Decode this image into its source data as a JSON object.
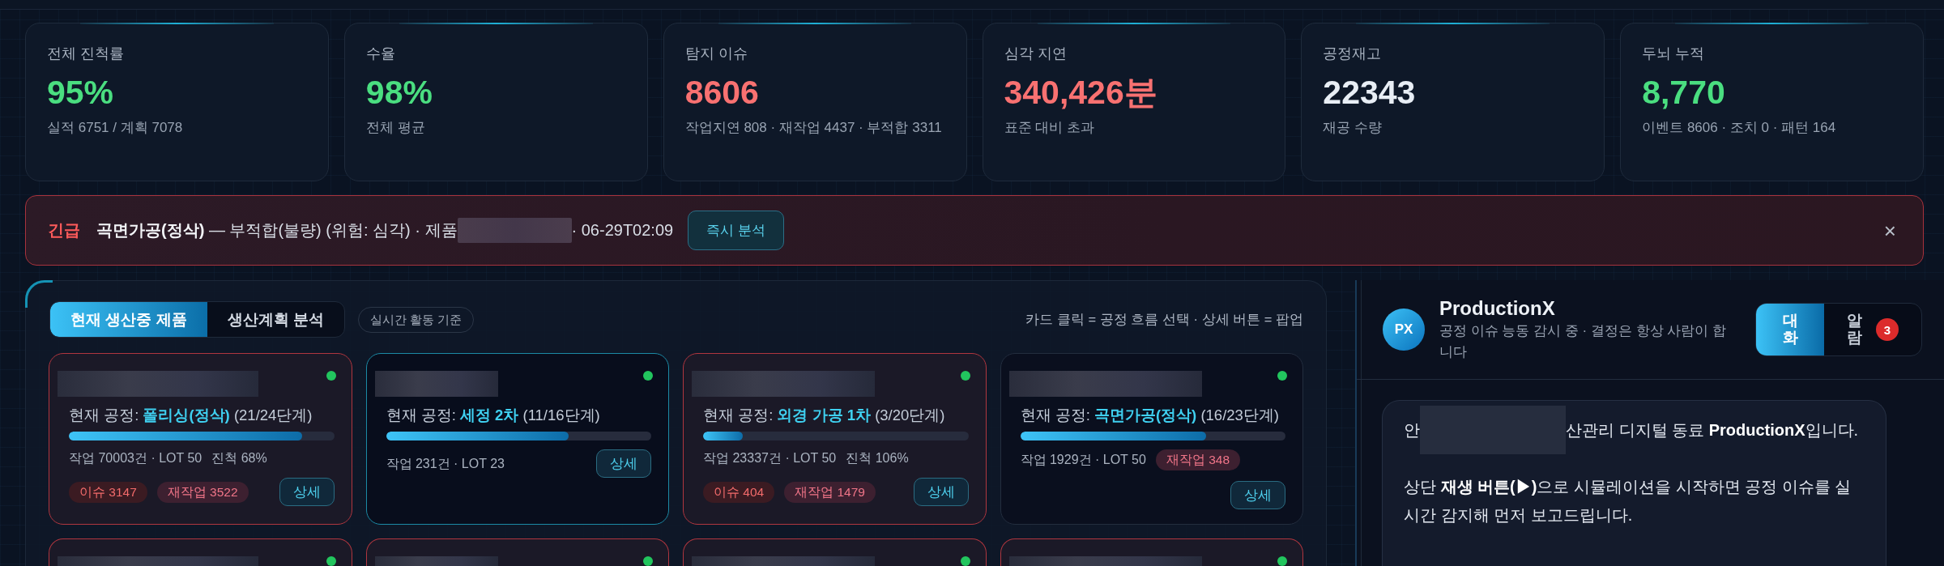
{
  "kpis": [
    {
      "label": "전체 진척률",
      "value": "95%",
      "color": "#4ade80",
      "sub": "실적 6751 / 계획 7078"
    },
    {
      "label": "수율",
      "value": "98%",
      "color": "#4ade80",
      "sub": "전체 평균"
    },
    {
      "label": "탐지 이슈",
      "value": "8606",
      "color": "#f87171",
      "sub": "작업지연 808 · 재작업 4437 · 부적합 3311"
    },
    {
      "label": "심각 지연",
      "value": "340,426분",
      "color": "#f87171",
      "sub": "표준 대비 초과"
    },
    {
      "label": "공정재고",
      "value": "22343",
      "color": "#e8eef5",
      "sub": "재공 수량"
    },
    {
      "label": "두뇌 누적",
      "value": "8,770",
      "color": "#4ade80",
      "sub": "이벤트 8606 · 조치 0 · 패턴 164"
    }
  ],
  "alert": {
    "tag": "긴급",
    "text": "**곡면가공(정삭)** — 부적합(불량) (위험: 심각) · 제품",
    "redacted": true,
    "time": "· 06-29T02:09",
    "action": "즉시 분석",
    "close": "×"
  },
  "production": {
    "tabs": [
      {
        "label": "현재 생산중 제품",
        "selected": true
      },
      {
        "label": "생산계획 분석",
        "selected": false
      }
    ],
    "badge": "실시간 활동 기준",
    "hint": "카드 클릭 = 공정 흐름 선택 · 상세 버튼 = 팝업",
    "cards": [
      {
        "name_redacted": true,
        "color": "#22c55e",
        "alert": true,
        "selected": false,
        "process": "현재 공정: **폴리싱(정삭)** (21/24단계)",
        "level": 0.88,
        "work": "작업 70003건 · LOT 50",
        "progress": "진척 68%",
        "chips": [
          {
            "kind": "issue",
            "label": "이슈 3147"
          },
          {
            "kind": "rework",
            "label": "재작업 3522"
          }
        ],
        "detail": "상세"
      },
      {
        "name_redacted": true,
        "color": "#22c55e",
        "alert": false,
        "selected": true,
        "process": "현재 공정: **세정 2차** (11/16단계)",
        "level": 0.69,
        "work": "작업 231건 · LOT 23",
        "detail": "상세"
      },
      {
        "name_redacted": true,
        "color": "#22c55e",
        "alert": true,
        "selected": false,
        "process": "현재 공정: **외경 가공 1차** (3/20단계)",
        "level": 0.15,
        "work": "작업 23337건 · LOT 50",
        "progress": "진척 106%",
        "chips": [
          {
            "kind": "issue",
            "label": "이슈 404"
          },
          {
            "kind": "rework",
            "label": "재작업 1479"
          }
        ],
        "detail": "상세"
      },
      {
        "name_redacted": true,
        "color": "#22c55e",
        "alert": false,
        "selected": false,
        "process": "현재 공정: **곡면가공(정삭)** (16/23단계)",
        "level": 0.7,
        "work": "작업 1929건 · LOT 50",
        "chips": [
          {
            "kind": "rework",
            "label": "재작업 348"
          }
        ],
        "detail": "상세"
      }
    ],
    "more_cards": [
      {
        "name_redacted": true,
        "color": "#22c55e",
        "alert": true,
        "selected": false
      },
      {
        "name_redacted": true,
        "color": "#22c55e",
        "alert": true,
        "selected": false
      },
      {
        "name_redacted": true,
        "color": "#22c55e",
        "alert": true,
        "selected": false
      },
      {
        "name_redacted": true,
        "color": "#22c55e",
        "alert": true,
        "selected": false
      }
    ]
  },
  "assistant": {
    "avatar": "PX",
    "name": "ProductionX",
    "status": "공정 이슈 능동 감시 중 · 결정은 항상 사람이 합니다",
    "tabs": [
      {
        "label": "대화",
        "selected": true
      },
      {
        "label": "알람",
        "selected": false,
        "badge": "3"
      }
    ],
    "messages": [
      {
        "paragraphs": [
          {
            "segments": [
              {
                "kind": "text",
                "text": "안"
              },
              {
                "kind": "redacted"
              },
              {
                "kind": "text",
                "text": "산관리 디지털 동료 **ProductionX**입니다."
              }
            ]
          },
          {
            "segments": [
              {
                "kind": "text",
                "text": "상단 **재생 버튼(▶)**으로 시뮬레이션을 시작하면 공정 이슈를 실시간 감지해 먼저 보고드립니다."
              }
            ]
          }
        ]
      }
    ]
  }
}
